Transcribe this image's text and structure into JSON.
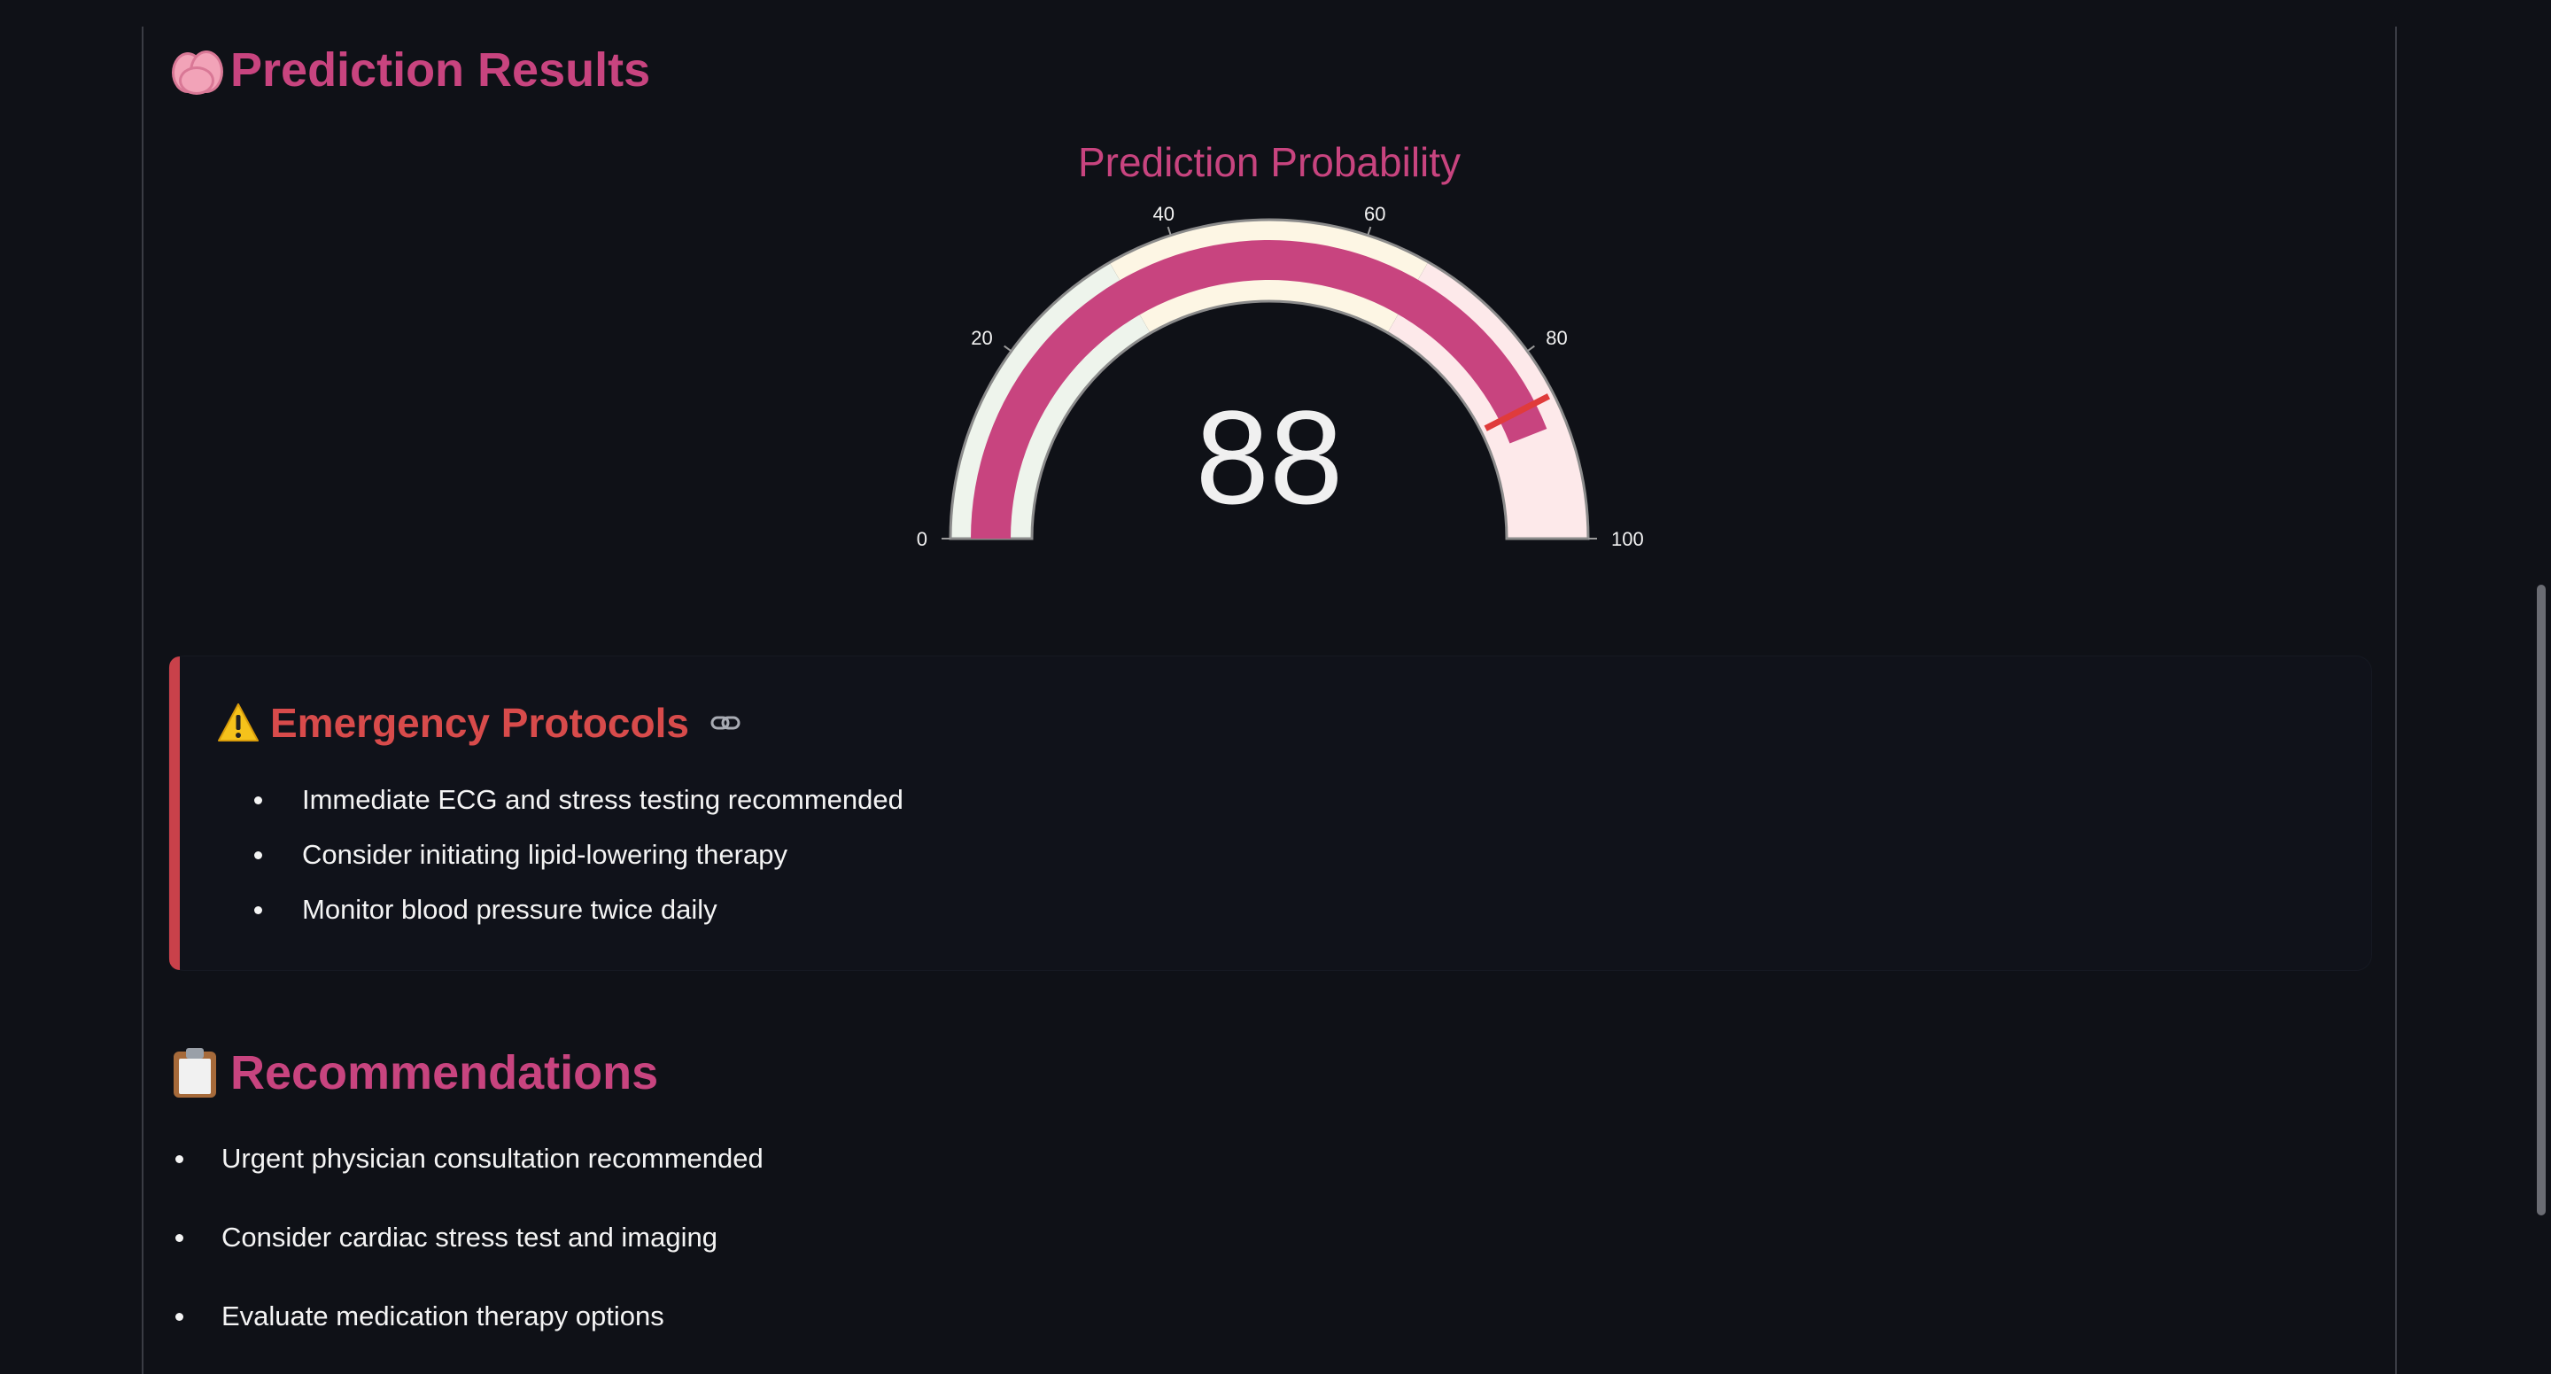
{
  "prediction": {
    "heading": "Prediction Results",
    "heading_icon": "brain-icon"
  },
  "gauge": {
    "title": "Prediction Probability",
    "value": 88,
    "value_text": "88",
    "min": 0,
    "max": 100,
    "ticks": [
      "0",
      "20",
      "40",
      "60",
      "80",
      "100"
    ],
    "threshold": 85,
    "bar_color": "#c8447f",
    "threshold_color": "#e03b3b",
    "band_colors": [
      "#eef4ec",
      "#fdf6e4",
      "#fde9ea"
    ]
  },
  "alert": {
    "heading": "Emergency Protocols",
    "heading_icon": "warning-icon",
    "link_icon": "link-icon",
    "items": [
      "Immediate ECG and stress testing recommended",
      "Consider initiating lipid-lowering therapy",
      "Monitor blood pressure twice daily"
    ],
    "accent_color": "#c9414a"
  },
  "recommendations": {
    "heading": "Recommendations",
    "heading_icon": "clipboard-icon",
    "items": [
      "Urgent physician consultation recommended",
      "Consider cardiac stress test and imaging",
      "Evaluate medication therapy options"
    ]
  },
  "colors": {
    "background": "#0f1117",
    "heading": "#c8447f",
    "text": "#f4f4f4"
  }
}
